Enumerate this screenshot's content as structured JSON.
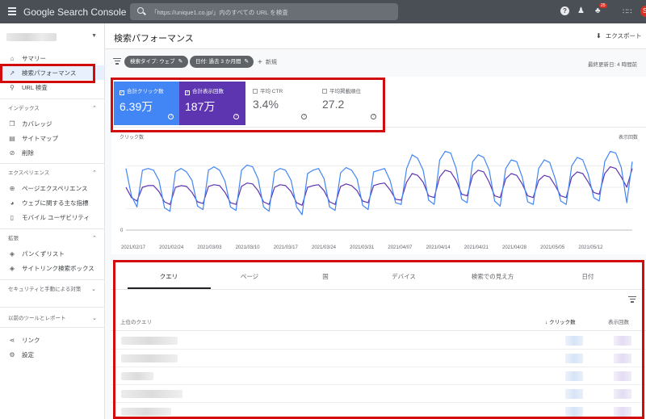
{
  "topbar": {
    "brand": "Google Search Console",
    "search_placeholder": "「https://unique1.co.jp/」内のすべての URL を検査",
    "notification_count": "25",
    "avatar_letter": "S"
  },
  "sidebar": {
    "items": [
      {
        "label": "サマリー",
        "icon": "home-icon"
      },
      {
        "label": "検索パフォーマンス",
        "icon": "trending-up-icon"
      },
      {
        "label": "URL 検査",
        "icon": "search-icon"
      }
    ],
    "sections": [
      {
        "title": "インデックス",
        "items": [
          {
            "label": "カバレッジ",
            "icon": "file-copy-icon"
          },
          {
            "label": "サイトマップ",
            "icon": "sitemap-icon"
          },
          {
            "label": "削除",
            "icon": "eye-off-icon"
          }
        ]
      },
      {
        "title": "エクスペリエンス",
        "items": [
          {
            "label": "ページエクスペリエンス",
            "icon": "add-circle-icon"
          },
          {
            "label": "ウェブに関する主な指標",
            "icon": "speed-icon"
          },
          {
            "label": "モバイル ユーザビリティ",
            "icon": "phone-icon"
          }
        ]
      },
      {
        "title": "拡張",
        "items": [
          {
            "label": "パンくずリスト",
            "icon": "layers-icon"
          },
          {
            "label": "サイトリンク検索ボックス",
            "icon": "layers-icon"
          }
        ]
      },
      {
        "title": "セキュリティと手動による対策",
        "items": []
      },
      {
        "title": "以前のツールとレポート",
        "items": [
          {
            "label": "リンク",
            "icon": "link-icon"
          },
          {
            "label": "設定",
            "icon": "settings-icon"
          }
        ]
      }
    ]
  },
  "header": {
    "title": "検索パフォーマンス",
    "export_label": "エクスポート"
  },
  "filters": {
    "search_type": "検索タイプ: ウェブ",
    "date": "日付: 過去 3 か月間",
    "new_label": "新規",
    "last_updated": "最終更新日: 4 時間前"
  },
  "metrics": [
    {
      "label": "合計クリック数",
      "value": "6.39万",
      "checked": true,
      "color": "#4285f4"
    },
    {
      "label": "合計表示回数",
      "value": "187万",
      "checked": true,
      "color": "#5e35b1"
    },
    {
      "label": "平均 CTR",
      "value": "3.4%",
      "checked": false
    },
    {
      "label": "平均掲載順位",
      "value": "27.2",
      "checked": false
    }
  ],
  "chart_data": {
    "type": "line",
    "yleft_label": "クリック数",
    "yright_label": "表示回数",
    "yleft_ticks": [
      "0"
    ],
    "x_ticks": [
      "2021/02/17",
      "2021/02/24",
      "2021/03/03",
      "2021/03/10",
      "2021/03/17",
      "2021/03/24",
      "2021/03/31",
      "2021/04/07",
      "2021/04/14",
      "2021/04/21",
      "2021/04/28",
      "2021/05/05",
      "2021/05/12"
    ],
    "series": [
      {
        "name": "クリック数",
        "color": "#4285f4",
        "values": [
          0.72,
          0.4,
          0.27,
          0.7,
          0.72,
          0.7,
          0.58,
          0.26,
          0.22,
          0.68,
          0.72,
          0.68,
          0.58,
          0.28,
          0.24,
          0.7,
          0.74,
          0.7,
          0.57,
          0.27,
          0.23,
          0.7,
          0.76,
          0.74,
          0.6,
          0.27,
          0.22,
          0.68,
          0.72,
          0.7,
          0.58,
          0.27,
          0.18,
          0.66,
          0.7,
          0.72,
          0.6,
          0.27,
          0.23,
          0.67,
          0.73,
          0.7,
          0.6,
          0.29,
          0.24,
          0.68,
          0.7,
          0.72,
          0.58,
          0.32,
          0.3,
          0.72,
          0.88,
          0.84,
          0.7,
          0.35,
          0.3,
          0.82,
          0.92,
          0.9,
          0.72,
          0.36,
          0.32,
          0.8,
          0.88,
          0.85,
          0.7,
          0.34,
          0.28,
          0.72,
          0.82,
          0.8,
          0.62,
          0.33,
          0.3,
          0.72,
          0.82,
          0.79,
          0.6,
          0.34,
          0.3,
          0.75,
          0.85,
          0.82,
          0.65,
          0.38,
          0.34,
          0.8,
          0.92,
          0.9,
          0.73,
          0.32,
          0.8
        ]
      },
      {
        "name": "表示回数",
        "color": "#5e35b1",
        "values": [
          0.5,
          0.38,
          0.34,
          0.5,
          0.52,
          0.52,
          0.45,
          0.33,
          0.3,
          0.5,
          0.52,
          0.51,
          0.44,
          0.33,
          0.31,
          0.51,
          0.53,
          0.52,
          0.44,
          0.32,
          0.3,
          0.51,
          0.55,
          0.54,
          0.46,
          0.33,
          0.3,
          0.5,
          0.53,
          0.52,
          0.45,
          0.32,
          0.29,
          0.5,
          0.52,
          0.53,
          0.46,
          0.33,
          0.3,
          0.51,
          0.54,
          0.52,
          0.46,
          0.34,
          0.32,
          0.52,
          0.54,
          0.55,
          0.47,
          0.36,
          0.35,
          0.56,
          0.66,
          0.64,
          0.56,
          0.4,
          0.38,
          0.62,
          0.7,
          0.68,
          0.58,
          0.42,
          0.4,
          0.64,
          0.7,
          0.68,
          0.56,
          0.4,
          0.38,
          0.6,
          0.66,
          0.64,
          0.54,
          0.4,
          0.38,
          0.58,
          0.64,
          0.62,
          0.52,
          0.4,
          0.38,
          0.62,
          0.68,
          0.66,
          0.56,
          0.44,
          0.42,
          0.66,
          0.74,
          0.72,
          0.62,
          0.5,
          0.72
        ]
      }
    ]
  },
  "tabs": [
    "クエリ",
    "ページ",
    "国",
    "デバイス",
    "検索での見え方",
    "日付"
  ],
  "table": {
    "col_query": "上位のクエリ",
    "col_clicks": "クリック数",
    "col_impressions": "表示回数"
  },
  "colors": {
    "highlight_border": "#d20c0c",
    "topbar_bg": "#4a4f55"
  }
}
